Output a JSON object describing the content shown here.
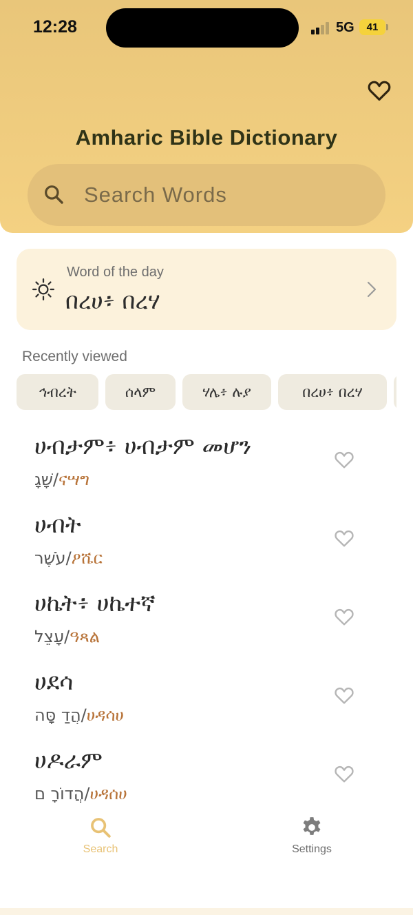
{
  "status_bar": {
    "time": "12:28",
    "network": "5G",
    "battery": "41"
  },
  "header": {
    "title": "Amharic Bible Dictionary"
  },
  "search": {
    "placeholder": "Search Words"
  },
  "word_of_the_day": {
    "label": "Word of the day",
    "word": "በረሀ፥ በረሃ"
  },
  "recent": {
    "label": "Recently viewed",
    "chips": [
      "ኅብረት",
      "ሰላም",
      "ሃሌ፥ ሉያ",
      "በረሀ፥ በረሃ"
    ]
  },
  "words": [
    {
      "title": "ሀብታም፥ ሀብታም መሆን",
      "hebrew": "שָׁגָ",
      "translit": "ናሣግ"
    },
    {
      "title": "ሀብት",
      "hebrew": "עֹשֶׁר",
      "translit": "ዖሼር"
    },
    {
      "title": "ሀኬት፥ ሀኬተኛ",
      "hebrew": "עָצֵל",
      "translit": "ዓጻል"
    },
    {
      "title": "ሀደሳ",
      "hebrew": "הֲדַ סָּה",
      "translit": "ሀዳሳሀ"
    },
    {
      "title": "ሀዶራም",
      "hebrew": "הֲדוֹרָ ם",
      "translit": "ሀዳሰሀ"
    }
  ],
  "tabs": {
    "search": "Search",
    "settings": "Settings"
  },
  "colors": {
    "accent": "#e8c275",
    "header": "#f2cf80",
    "translit": "#b8743a"
  }
}
